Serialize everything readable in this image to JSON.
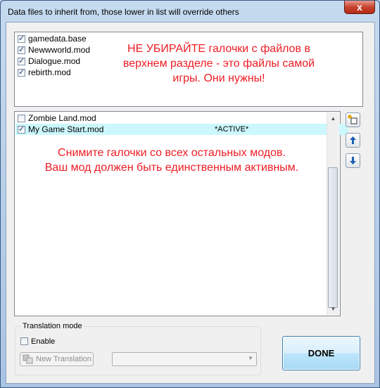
{
  "window": {
    "title": "Data files to inherit from, those lower in list will override others",
    "close_glyph": "x"
  },
  "base_list": {
    "items": [
      {
        "label": "gamedata.base",
        "checked": true
      },
      {
        "label": "Newwworld.mod",
        "checked": true
      },
      {
        "label": "Dialogue.mod",
        "checked": true
      },
      {
        "label": "rebirth.mod",
        "checked": true
      }
    ],
    "note_line1": "НЕ УБИРАЙТЕ галочки с файлов в",
    "note_line2": "верхнем разделе - это файлы самой",
    "note_line3": "игры. Они нужны!"
  },
  "mod_list": {
    "items": [
      {
        "label": "Zombie Land.mod",
        "checked": false
      },
      {
        "label": "My Game Start.mod",
        "checked": true,
        "selected": true,
        "status": "*ACTIVE*"
      }
    ],
    "note_line1": "Снимите галочки со всех остальных модов.",
    "note_line2": "Ваш мод должен быть единственным активным."
  },
  "side_buttons": {
    "new_icon": "new-item-icon",
    "up_icon": "arrow-up-icon",
    "down_icon": "arrow-down-icon"
  },
  "translation": {
    "group_label": "Translation mode",
    "enable_label": "Enable",
    "enable_checked": false,
    "new_translation_label": "New Translation",
    "language_value": ""
  },
  "done_label": "DONE",
  "colors": {
    "note": "#ee1c24",
    "selected_row": "#ccf7fd"
  }
}
